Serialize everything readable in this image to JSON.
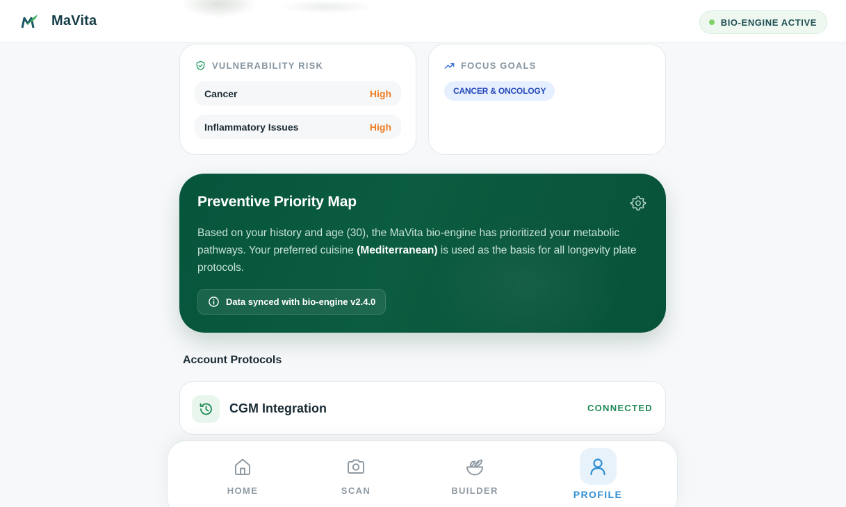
{
  "app": {
    "brand": "MaVita",
    "status": "BIO-ENGINE ACTIVE"
  },
  "colors": {
    "accent_green": "#06553c",
    "risk_high": "#f07d22",
    "goal_chip_text": "#2448b8",
    "connected": "#1f8a55",
    "nav_active": "#2f8fd3",
    "status_dot": "#7fd36a"
  },
  "vulnerability": {
    "title": "VULNERABILITY RISK",
    "icon": "shield-check-icon",
    "items": [
      {
        "name": "Cancer",
        "level": "High"
      },
      {
        "name": "Inflammatory Issues",
        "level": "High"
      }
    ]
  },
  "goals": {
    "title": "FOCUS GOALS",
    "icon": "trending-up-icon",
    "chips": [
      "CANCER & ONCOLOGY"
    ]
  },
  "priority_map": {
    "title": "Preventive Priority Map",
    "body_part1": "Based on your history and age (30), the MaVita bio-engine has prioritized your metabolic pathways. Your preferred cuisine ",
    "body_bold": "(Mediterranean)",
    "body_part2": " is used as the basis for all longevity plate protocols.",
    "sync_text": "Data synced with bio-engine v2.4.0",
    "settings_icon": "gear-icon",
    "info_icon": "info-icon"
  },
  "protocols": {
    "title": "Account Protocols",
    "items": [
      {
        "name": "CGM Integration",
        "status": "CONNECTED",
        "icon": "history-icon"
      }
    ]
  },
  "nav": {
    "items": [
      {
        "label": "HOME",
        "icon": "home-icon",
        "active": false
      },
      {
        "label": "SCAN",
        "icon": "camera-icon",
        "active": false
      },
      {
        "label": "BUILDER",
        "icon": "salad-bowl-icon",
        "active": false
      },
      {
        "label": "PROFILE",
        "icon": "user-icon",
        "active": true
      }
    ]
  }
}
